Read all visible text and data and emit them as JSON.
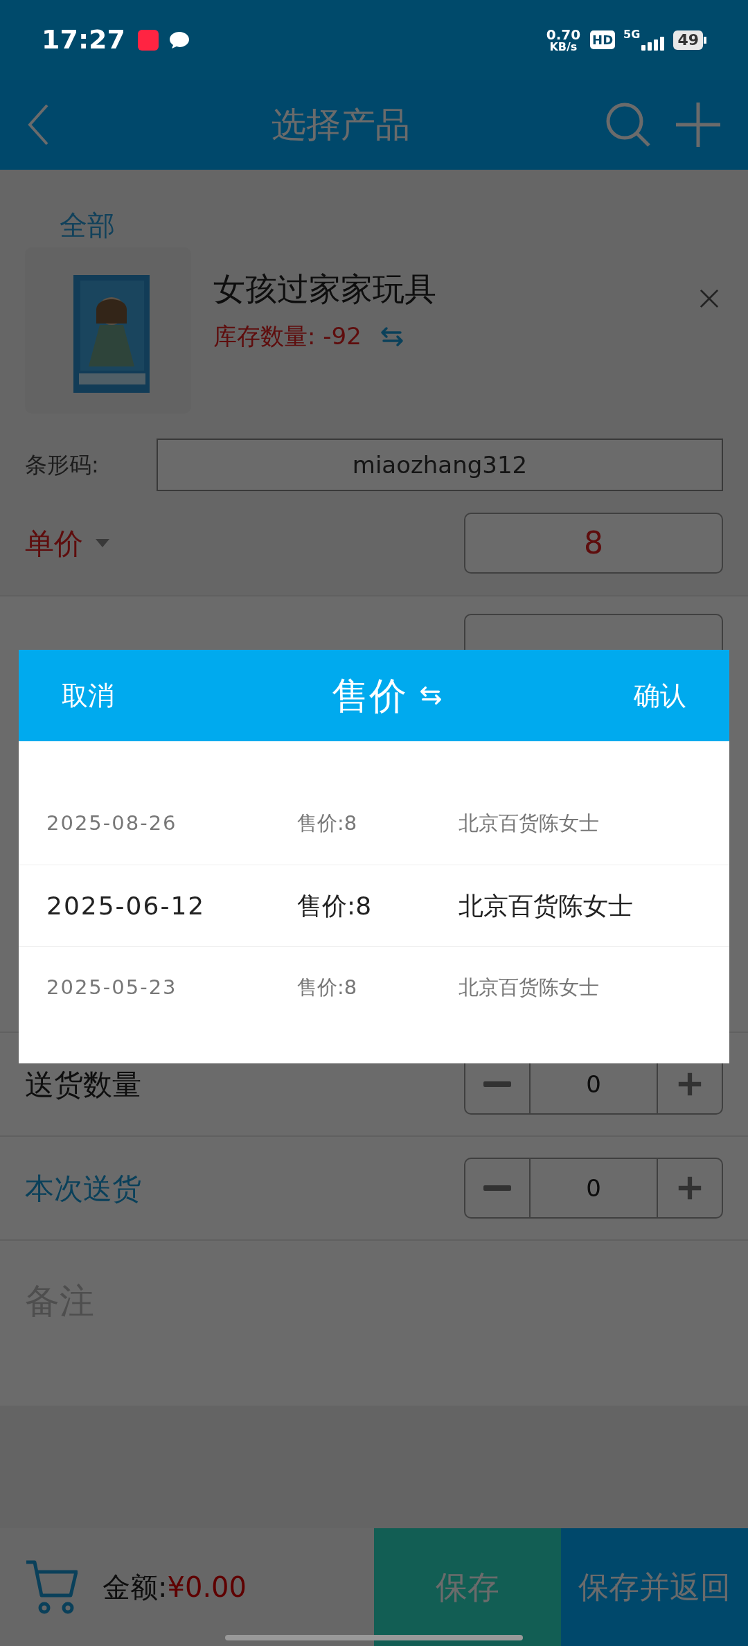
{
  "status_bar": {
    "time": "17:27",
    "speed": "0.70",
    "speed_unit": "KB/s",
    "hd": "HD",
    "network": "5G",
    "battery": "49"
  },
  "header": {
    "title": "选择产品"
  },
  "category": {
    "label": "全部"
  },
  "product": {
    "name": "女孩过家家玩具",
    "stock": "库存数量: -92"
  },
  "barcode": {
    "label": "条形码:",
    "value": "miaozhang312"
  },
  "price": {
    "label": "单价",
    "value": "8"
  },
  "picker": {
    "cancel": "取消",
    "title": "售价",
    "confirm": "确认",
    "rows": [
      {
        "date": "2025-08-26",
        "price": "售价:8",
        "customer": "北京百货陈女士",
        "selected": false
      },
      {
        "date": "2025-06-12",
        "price": "售价:8",
        "customer": "北京百货陈女士",
        "selected": true
      },
      {
        "date": "2025-05-23",
        "price": "售价:8",
        "customer": "北京百货陈女士",
        "selected": false
      }
    ]
  },
  "quantities": [
    {
      "label": "送货数量",
      "value": "0",
      "highlighted": false
    },
    {
      "label": "本次送货",
      "value": "0",
      "highlighted": true
    }
  ],
  "remarks": {
    "placeholder": "备注"
  },
  "footer": {
    "amount_label": "金额:",
    "amount": "¥0.00",
    "buttons": [
      "保存",
      "保存并返回"
    ]
  }
}
